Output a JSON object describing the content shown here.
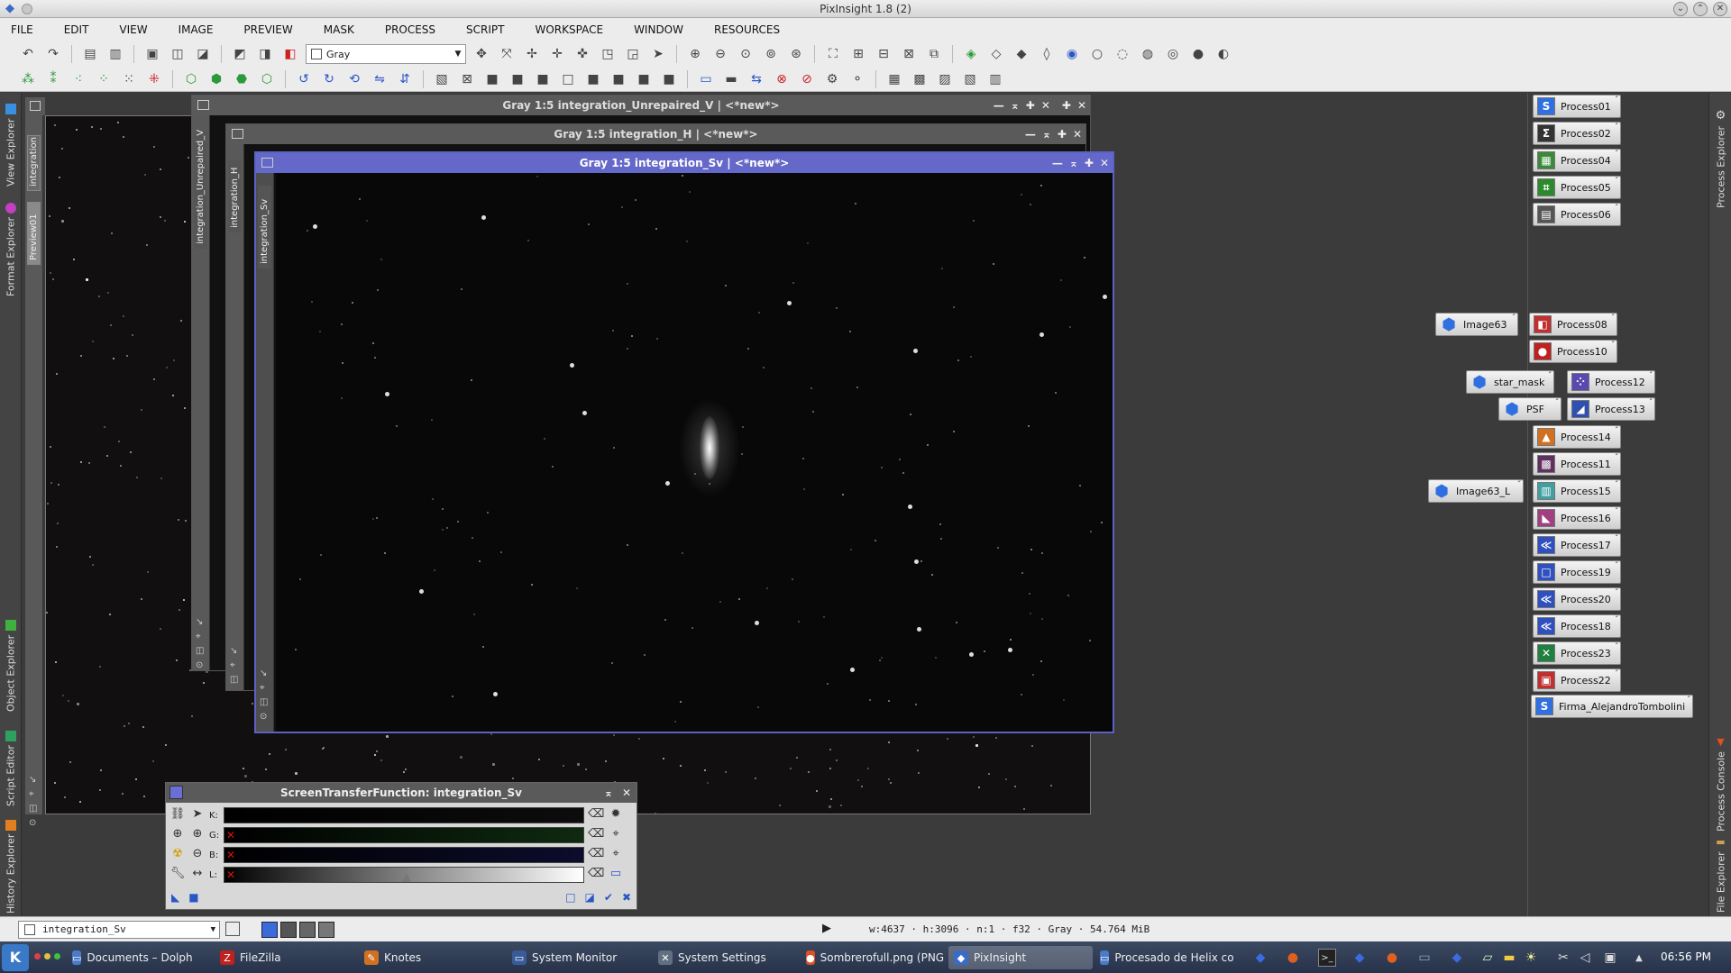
{
  "app": {
    "title": "PixInsight 1.8 (2)",
    "menu": [
      "FILE",
      "EDIT",
      "VIEW",
      "IMAGE",
      "PREVIEW",
      "MASK",
      "PROCESS",
      "SCRIPT",
      "WORKSPACE",
      "WINDOW",
      "RESOURCES"
    ],
    "channel_combo": "Gray"
  },
  "left_dock": {
    "tabs": [
      "View Explorer",
      "Format Explorer",
      "Object Explorer",
      "Script Editor",
      "History Explorer"
    ]
  },
  "right_dock": {
    "tabs": [
      "Process Explorer",
      "Process Console",
      "File Explorer"
    ]
  },
  "windows": {
    "bg_tabs": [
      "integration",
      "Preview01"
    ],
    "unrepaired": {
      "title": "Gray 1:5 integration_Unrepaired_V | <*new*>",
      "tab": "integration_Unrepaired_V"
    },
    "h": {
      "title": "Gray 1:5 integration_H | <*new*>",
      "tab": "integration_H"
    },
    "sv": {
      "title": "Gray 1:5 integration_Sv | <*new*>",
      "tab": "integration_Sv"
    }
  },
  "process_icons": [
    {
      "label": "Process01",
      "symbol": "S",
      "color": "#2f6fe0"
    },
    {
      "label": "Process02",
      "symbol": "Σ",
      "color": "#333333"
    },
    {
      "label": "Process04",
      "symbol": "▦",
      "color": "#3a8a3a"
    },
    {
      "label": "Process05",
      "symbol": "⌗",
      "color": "#2c8a2c"
    },
    {
      "label": "Process06",
      "symbol": "▤",
      "color": "#555555"
    },
    {
      "label": "Process08",
      "symbol": "◧",
      "color": "#c03030"
    },
    {
      "label": "Process10",
      "symbol": "●",
      "color": "#c02020"
    },
    {
      "label": "Process12",
      "symbol": "⁘",
      "color": "#5a4ab0"
    },
    {
      "label": "Process13",
      "symbol": "◢",
      "color": "#3050b0"
    },
    {
      "label": "Process14",
      "symbol": "▲",
      "color": "#d07020"
    },
    {
      "label": "Process11",
      "symbol": "▩",
      "color": "#603060"
    },
    {
      "label": "Process15",
      "symbol": "▥",
      "color": "#40a0a0"
    },
    {
      "label": "Process16",
      "symbol": "◣",
      "color": "#a04080"
    },
    {
      "label": "Process17",
      "symbol": "≪",
      "color": "#3050c0"
    },
    {
      "label": "Process19",
      "symbol": "□",
      "color": "#3050c0"
    },
    {
      "label": "Process20",
      "symbol": "≪",
      "color": "#3050c0"
    },
    {
      "label": "Process18",
      "symbol": "≪",
      "color": "#3050c0"
    },
    {
      "label": "Process23",
      "symbol": "✕",
      "color": "#208040"
    },
    {
      "label": "Process22",
      "symbol": "▣",
      "color": "#c03030"
    },
    {
      "label": "Firma_AlejandroTombolini",
      "symbol": "S",
      "color": "#2f6fe0"
    }
  ],
  "image_icons": [
    "Image63",
    "star_mask",
    "PSF",
    "Image63_L"
  ],
  "stf": {
    "title": "ScreenTransferFunction: integration_Sv",
    "channels": [
      "K:",
      "G:",
      "B:",
      "L:"
    ],
    "x_mark": "✕"
  },
  "status": {
    "view": "integration_Sv",
    "info": "w:4637 · h:3096 · n:1 · f32 · Gray · 54.764 MiB"
  },
  "taskbar": {
    "items": [
      {
        "label": "Documents – Dolphin",
        "icon": "▭",
        "color": "#4a7ac8"
      },
      {
        "label": "FileZilla",
        "icon": "Z",
        "color": "#c02020"
      },
      {
        "label": "Knotes",
        "icon": "✎",
        "color": "#d07020"
      },
      {
        "label": "System Monitor",
        "icon": "▭",
        "color": "#3a5a9a"
      },
      {
        "label": "System Settings",
        "icon": "✕",
        "color": "#607080"
      },
      {
        "label": "Sombrerofull.png (PNG",
        "icon": "●",
        "color": "#e05020"
      },
      {
        "label": "PixInsight",
        "icon": "◆",
        "color": "#3a6bc7"
      },
      {
        "label": "Procesado de Helix co",
        "icon": "▭",
        "color": "#4a7ac8"
      }
    ],
    "clock": "06:56 PM"
  }
}
